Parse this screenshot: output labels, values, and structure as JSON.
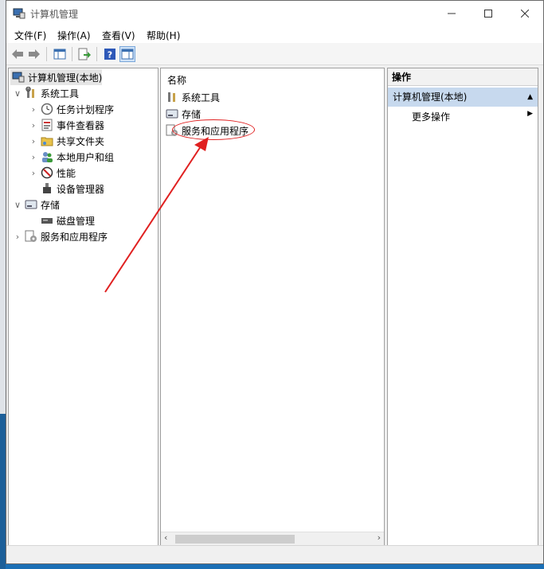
{
  "window": {
    "title": "计算机管理"
  },
  "menu": [
    "文件(F)",
    "操作(A)",
    "查看(V)",
    "帮助(H)"
  ],
  "tree": {
    "root": "计算机管理(本地)",
    "system_tools": "系统工具",
    "task_scheduler": "任务计划程序",
    "event_viewer": "事件查看器",
    "shared_folders": "共享文件夹",
    "local_users": "本地用户和组",
    "performance": "性能",
    "device_manager": "设备管理器",
    "storage": "存储",
    "disk_management": "磁盘管理",
    "services_apps": "服务和应用程序"
  },
  "list": {
    "column_header": "名称",
    "items": [
      "系统工具",
      "存储",
      "服务和应用程序"
    ]
  },
  "actions": {
    "header": "操作",
    "group": "计算机管理(本地)",
    "more": "更多操作"
  },
  "colors": {
    "selection": "#c7d9ee",
    "annotation": "#e02020"
  }
}
